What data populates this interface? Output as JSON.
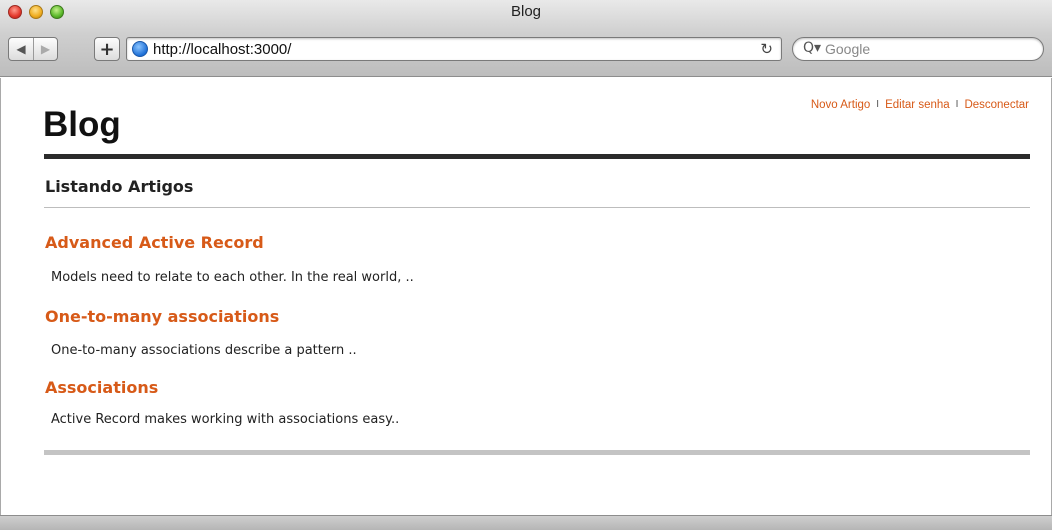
{
  "window": {
    "title": "Blog"
  },
  "toolbar": {
    "back_icon": "◀",
    "forward_icon": "▶",
    "add_icon": "+",
    "url": "http://localhost:3000/",
    "reload_icon": "↻"
  },
  "search": {
    "placeholder": "Google",
    "icon": "Q▾"
  },
  "header": {
    "site_title": "Blog",
    "links": [
      "Novo Artigo",
      "Editar senha",
      "Desconectar"
    ],
    "separator": "I"
  },
  "main": {
    "section_title": "Listando Artigos",
    "articles": [
      {
        "title": "Advanced Active Record",
        "summary": "Models need to relate to each other. In the real world, .."
      },
      {
        "title": "One-to-many associations",
        "summary": "One-to-many associations describe a pattern .."
      },
      {
        "title": "Associations",
        "summary": "Active Record makes working with associations easy.."
      }
    ]
  },
  "colors": {
    "link": "#d75a18",
    "rule_dark": "#2b2b2b",
    "rule_light": "#c4c4c4"
  }
}
